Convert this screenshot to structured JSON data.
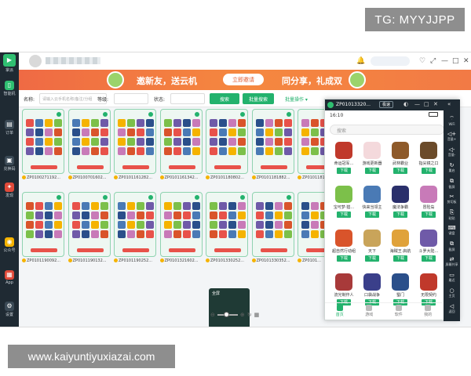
{
  "watermarks": {
    "top": "TG: MYYJJPP",
    "bottom": "www.kaiyuntiyuxiazai.com"
  },
  "sidebar": {
    "logo_icon": "app-logo-icon",
    "items": [
      {
        "label": "掌派",
        "icon": "app-logo-icon"
      },
      {
        "label": "智能机",
        "icon": "phone-icon",
        "active": true
      },
      {
        "label": "订单",
        "icon": "cart-icon"
      },
      {
        "label": "兑换码",
        "icon": "gift-icon"
      },
      {
        "label": "发现",
        "icon": "fire-icon"
      },
      {
        "label": "公众号",
        "icon": "wechat-icon"
      },
      {
        "label": "App",
        "icon": "app-icon"
      },
      {
        "label": "设置",
        "icon": "gear-icon"
      }
    ]
  },
  "topbar": {
    "window_controls": [
      "♡",
      "⤢",
      "—",
      "□",
      "✕"
    ]
  },
  "banner": {
    "title": "邀新友，送云机",
    "button": "立即邀请",
    "share": "同分享，礼成双"
  },
  "filters": {
    "name_label": "名称:",
    "name_placeholder": "请输入云手机名称/备注/分组",
    "level_label": "等级:",
    "status_label": "状态:",
    "search_button": "搜索",
    "batch_search_button": "批量搜索",
    "batch_ops": "批量操作 ▾"
  },
  "devices": [
    {
      "id": "ZP0100271192..."
    },
    {
      "id": "ZP0100701602..."
    },
    {
      "id": "ZP0101161282..."
    },
    {
      "id": "ZP0101161342..."
    },
    {
      "id": "ZP0101180802..."
    },
    {
      "id": "ZP0101181882..."
    },
    {
      "id": "ZP0101181..."
    },
    {
      "id": "ZP0101190092..."
    },
    {
      "id": "ZP0101190132..."
    },
    {
      "id": "ZP0101190252..."
    },
    {
      "id": "ZP0101321602..."
    },
    {
      "id": "ZP0101330252..."
    },
    {
      "id": "ZP0101330352..."
    },
    {
      "id": "ZP0101..."
    }
  ],
  "mini_panel": {
    "label": "全屏"
  },
  "float_window": {
    "title": "ZP01013320...",
    "quality": "极速",
    "controls": [
      "◐",
      "—",
      "□",
      "✕",
      "«"
    ],
    "time": "16:10",
    "search_placeholder": "搜索",
    "download_label": "下载",
    "apps": [
      {
        "name": "命运冠军…",
        "color": "#c0392b"
      },
      {
        "name": "游戏更新器",
        "color": "#f4d9dc"
      },
      {
        "name": "武林霸业",
        "color": "#8e5a2a"
      },
      {
        "name": "指尖镜之口",
        "color": "#6b4b2a"
      },
      {
        "name": "宝可梦·猎…",
        "color": "#7cc04a"
      },
      {
        "name": "快来当领主",
        "color": "#4a7ab5"
      },
      {
        "name": "魔法争霸",
        "color": "#2a2f6b"
      },
      {
        "name": "冒险岛",
        "color": "#c87ab8"
      },
      {
        "name": "超自然行动组",
        "color": "#d9542b"
      },
      {
        "name": "天下",
        "color": "#c9a45a"
      },
      {
        "name": "海贼王·启航",
        "color": "#e0a23a"
      },
      {
        "name": "斗罗大陆…",
        "color": "#6f5aa8"
      },
      {
        "name": "流光制作人",
        "color": "#a83a3a"
      },
      {
        "name": "口袋战争",
        "color": "#3a3f8a"
      },
      {
        "name": "蜀门",
        "color": "#2a4f8a"
      },
      {
        "name": "无限契约",
        "color": "#c0392b"
      }
    ],
    "nav": [
      {
        "label": "首页",
        "active": true
      },
      {
        "label": "游戏",
        "active": false
      },
      {
        "label": "软件",
        "active": false
      },
      {
        "label": "我的",
        "active": false
      }
    ],
    "side_tools": [
      "WiFi",
      "音量+",
      "音量-",
      "重启",
      "截屏",
      "剪切板",
      "粘贴",
      "键盘",
      "截屏",
      "屏幕共享",
      "最近",
      "主页",
      "返回"
    ]
  }
}
